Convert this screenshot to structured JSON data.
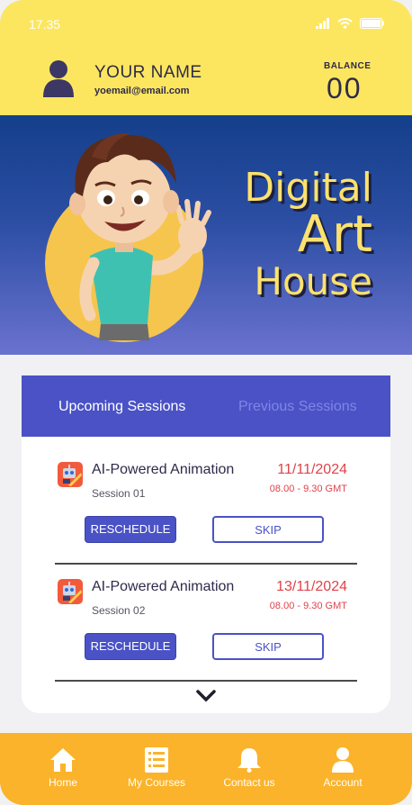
{
  "status_bar": {
    "time": "17.35"
  },
  "header": {
    "user_name": "YOUR NAME",
    "user_email": "yoemail@email.com",
    "balance_label": "BALANCE",
    "balance_value": "00"
  },
  "hero": {
    "title_line1": "Digital",
    "title_line2": "Art",
    "title_line3": "House"
  },
  "tabs": {
    "upcoming": "Upcoming Sessions",
    "previous": "Previous Sessions",
    "active": "upcoming"
  },
  "sessions": [
    {
      "title": "AI-Powered Animation",
      "subtitle": "Session 01",
      "date": "11/11/2024",
      "time": "08.00 - 9.30 GMT",
      "reschedule_label": "RESCHEDULE",
      "skip_label": "SKIP"
    },
    {
      "title": "AI-Powered Animation",
      "subtitle": "Session 02",
      "date": "13/11/2024",
      "time": "08.00 - 9.30 GMT",
      "reschedule_label": "RESCHEDULE",
      "skip_label": "SKIP"
    }
  ],
  "nav": [
    {
      "label": "Home",
      "icon": "home-icon"
    },
    {
      "label": "My Courses",
      "icon": "list-icon"
    },
    {
      "label": "Contact us",
      "icon": "bell-icon"
    },
    {
      "label": "Account",
      "icon": "user-icon"
    }
  ],
  "colors": {
    "header_bg": "#fce660",
    "accent": "#4a52c6",
    "date_red": "#e0424a",
    "nav_bg": "#fbb32b"
  }
}
